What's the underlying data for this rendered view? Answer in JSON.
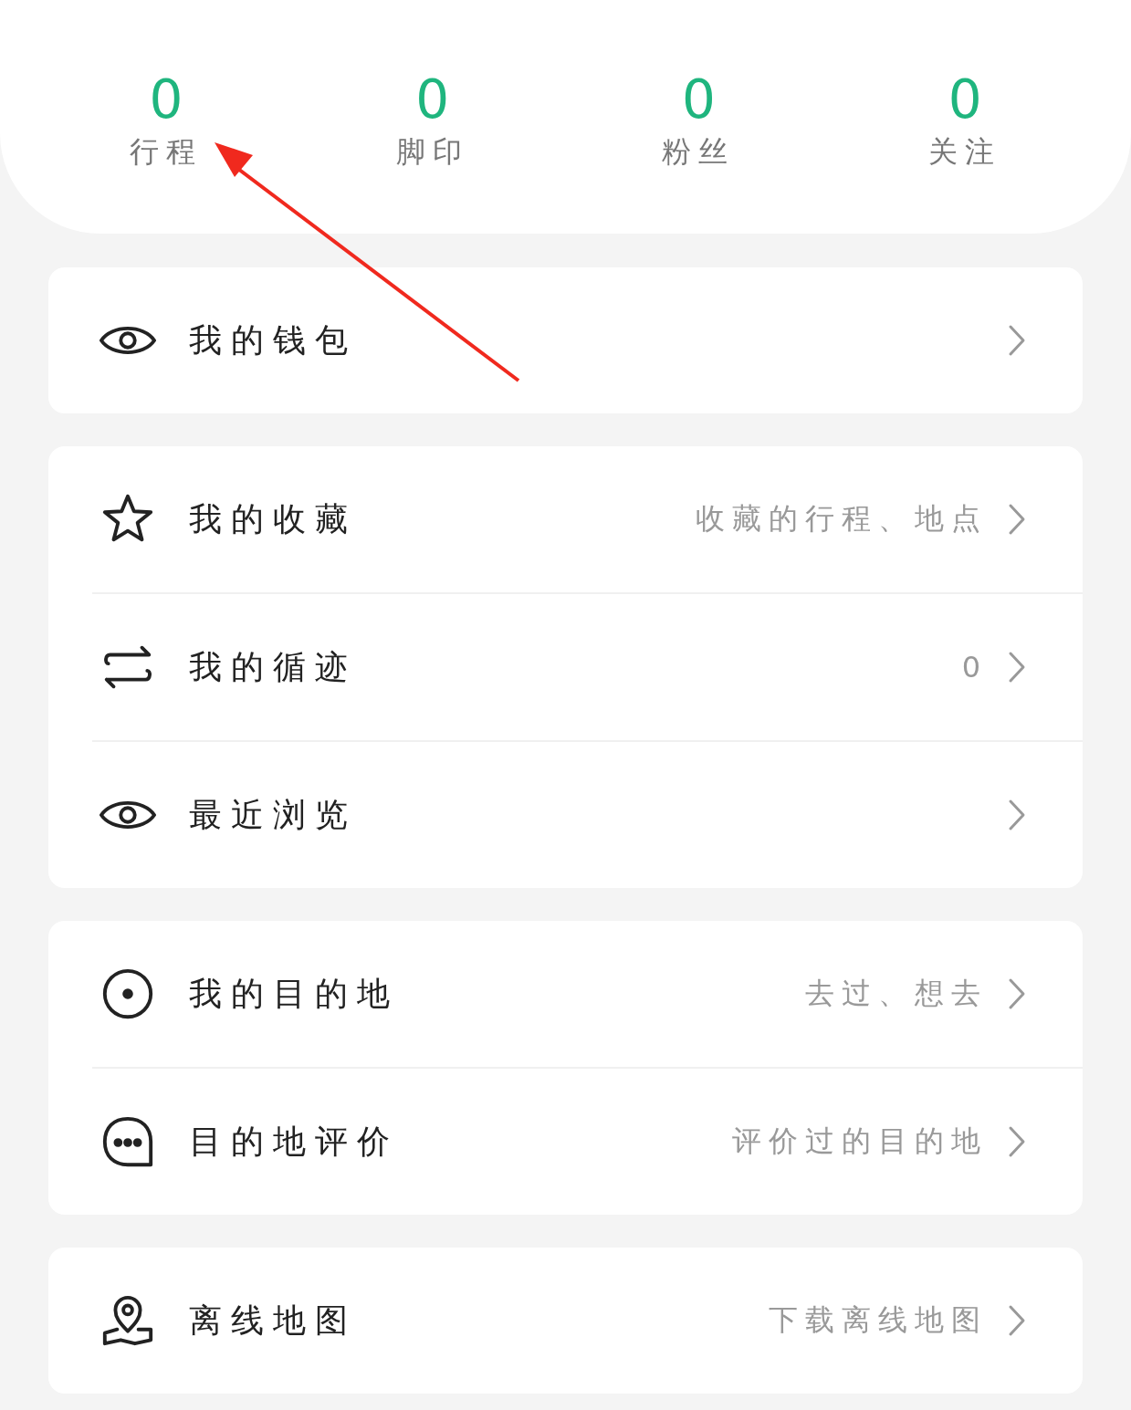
{
  "stats": [
    {
      "value": "0",
      "label": "行程"
    },
    {
      "value": "0",
      "label": "脚印"
    },
    {
      "value": "0",
      "label": "粉丝"
    },
    {
      "value": "0",
      "label": "关注"
    }
  ],
  "sections": [
    {
      "items": [
        {
          "kind": "eye",
          "label": "我的钱包"
        }
      ]
    },
    {
      "items": [
        {
          "kind": "star",
          "label": "我的收藏",
          "hint": "收藏的行程、地点"
        },
        {
          "kind": "swap",
          "label": "我的循迹",
          "hint": "0"
        },
        {
          "kind": "eye",
          "label": "最近浏览"
        }
      ]
    },
    {
      "items": [
        {
          "kind": "target",
          "label": "我的目的地",
          "hint": "去过、想去"
        },
        {
          "kind": "chat",
          "label": "目的地评价",
          "hint": "评价过的目的地"
        }
      ]
    },
    {
      "items": [
        {
          "kind": "pin",
          "label": "离线地图",
          "hint": "下载离线地图"
        }
      ]
    }
  ]
}
